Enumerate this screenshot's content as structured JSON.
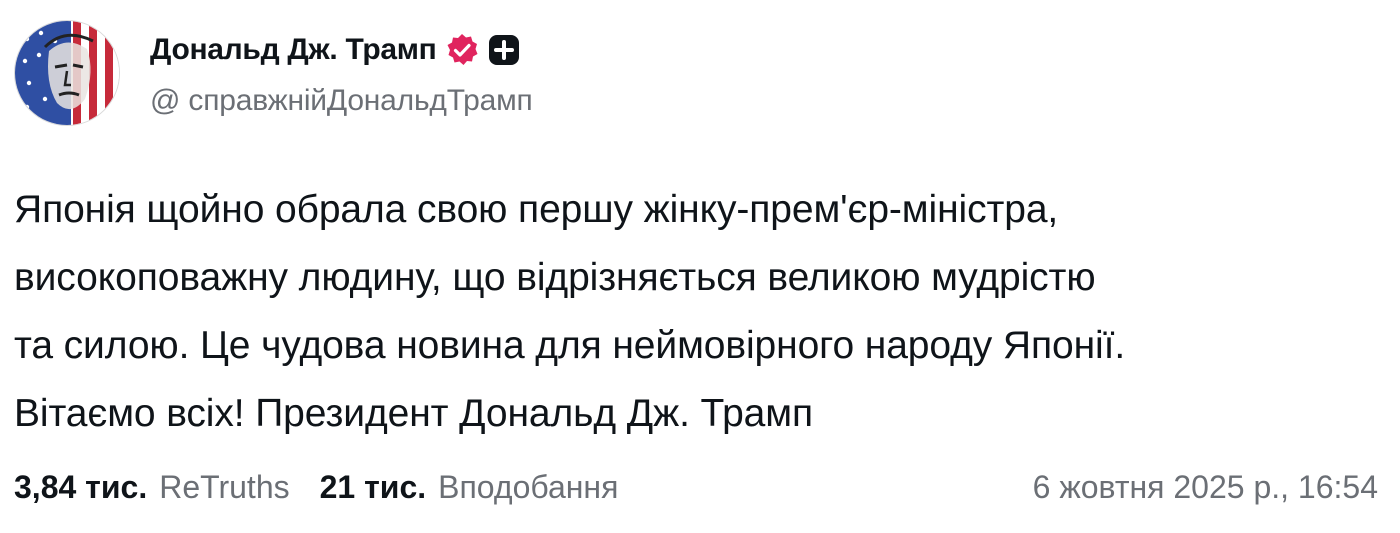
{
  "author": {
    "display_name": "Дональд Дж. Трамп",
    "handle": "@ справжнійДональдТрамп",
    "verified_badge_icon": "verified-badge-icon",
    "plus_badge_icon": "plus-badge-icon",
    "verified_color": "#e0245e"
  },
  "post": {
    "lines": [
      "Японія щойно обрала свою першу жінку-прем'єр-міністра,",
      "високоповажну людину, що відрізняється великою мудрістю",
      "та силою. Це чудова новина для неймовірного народу Японії.",
      "Вітаємо всіх! Президент Дональд Дж. Трамп"
    ]
  },
  "stats": {
    "retruths_count": "3,84 тис.",
    "retruths_label": "ReTruths",
    "likes_count": "21 тис.",
    "likes_label": "Вподобання"
  },
  "timestamp": "6 жовтня 2025 р., 16:54"
}
